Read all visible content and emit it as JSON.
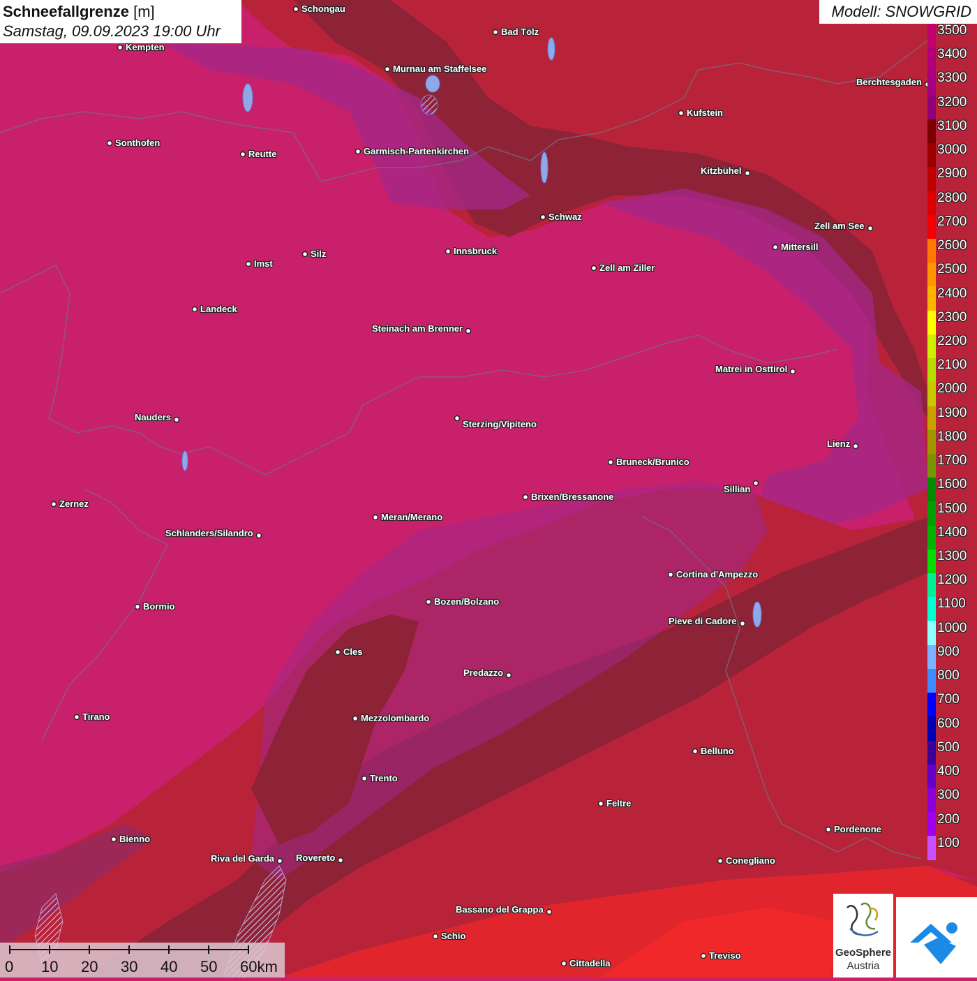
{
  "title": {
    "parameter": "Schneefallgrenze",
    "unit": "[m]",
    "datetime": "Samstag, 09.09.2023 19:00 Uhr"
  },
  "model": "Modell: SNOWGRID",
  "legend": {
    "labels": [
      "3500",
      "3400",
      "3300",
      "3200",
      "3100",
      "3000",
      "2900",
      "2800",
      "2700",
      "2600",
      "2500",
      "2400",
      "2300",
      "2200",
      "2100",
      "2000",
      "1900",
      "1800",
      "1700",
      "1600",
      "1500",
      "1400",
      "1300",
      "1200",
      "1100",
      "1000",
      "900",
      "800",
      "700",
      "600",
      "500",
      "400",
      "300",
      "200",
      "100"
    ],
    "colors": [
      "#c2006e",
      "#b2007a",
      "#a40080",
      "#90007a",
      "#7a0000",
      "#9a0000",
      "#be0000",
      "#dc0000",
      "#f50000",
      "#ff7800",
      "#ff9600",
      "#ffb400",
      "#ffff00",
      "#cdf000",
      "#b4dc00",
      "#c8c800",
      "#c8a000",
      "#a09600",
      "#789600",
      "#008c00",
      "#00a000",
      "#00b400",
      "#00dc00",
      "#00f09a",
      "#00ffd2",
      "#8cffff",
      "#78b4ff",
      "#3c8cff",
      "#0000ff",
      "#0000b4",
      "#3c0096",
      "#6400c8",
      "#8c00dc",
      "#a000f0",
      "#c850ff"
    ]
  },
  "cities": [
    {
      "name": "Schongau"
    },
    {
      "name": "Bad Tölz"
    },
    {
      "name": "Kempten"
    },
    {
      "name": "Murnau am Staffelsee"
    },
    {
      "name": "Berchtesgaden"
    },
    {
      "name": "Kufstein"
    },
    {
      "name": "Sonthofen"
    },
    {
      "name": "Reutte"
    },
    {
      "name": "Garmisch-Partenkirchen"
    },
    {
      "name": "Kitzbühel"
    },
    {
      "name": "Schwaz"
    },
    {
      "name": "Zell am See"
    },
    {
      "name": "Mittersill"
    },
    {
      "name": "Innsbruck"
    },
    {
      "name": "Imst"
    },
    {
      "name": "Silz"
    },
    {
      "name": "Zell am Ziller"
    },
    {
      "name": "Landeck"
    },
    {
      "name": "Steinach am Brenner"
    },
    {
      "name": "Matrei in Osttirol"
    },
    {
      "name": "Nauders"
    },
    {
      "name": "Sterzing/Vipiteno"
    },
    {
      "name": "Lienz"
    },
    {
      "name": "Bruneck/Brunico"
    },
    {
      "name": "Sillian"
    },
    {
      "name": "Zernez"
    },
    {
      "name": "Brixen/Bressanone"
    },
    {
      "name": "Meran/Merano"
    },
    {
      "name": "Schlanders/Silandro"
    },
    {
      "name": "Cortina d'Ampezzo"
    },
    {
      "name": "Bozen/Bolzano"
    },
    {
      "name": "Bormio"
    },
    {
      "name": "Pieve di Cadore"
    },
    {
      "name": "Cles"
    },
    {
      "name": "Predazzo"
    },
    {
      "name": "Tirano"
    },
    {
      "name": "Mezzolombardo"
    },
    {
      "name": "Belluno"
    },
    {
      "name": "Trento"
    },
    {
      "name": "Feltre"
    },
    {
      "name": "Bienno"
    },
    {
      "name": "Pordenone"
    },
    {
      "name": "Riva del Garda"
    },
    {
      "name": "Rovereto"
    },
    {
      "name": "Conegliano"
    },
    {
      "name": "Bassano del Grappa"
    },
    {
      "name": "Schio"
    },
    {
      "name": "Treviso"
    },
    {
      "name": "Cittadella"
    }
  ],
  "scalebar": {
    "ticks": [
      "0",
      "10",
      "20",
      "30",
      "40",
      "50",
      "60km"
    ]
  },
  "logo": {
    "line1": "GeoSphere",
    "line2": "Austria"
  }
}
